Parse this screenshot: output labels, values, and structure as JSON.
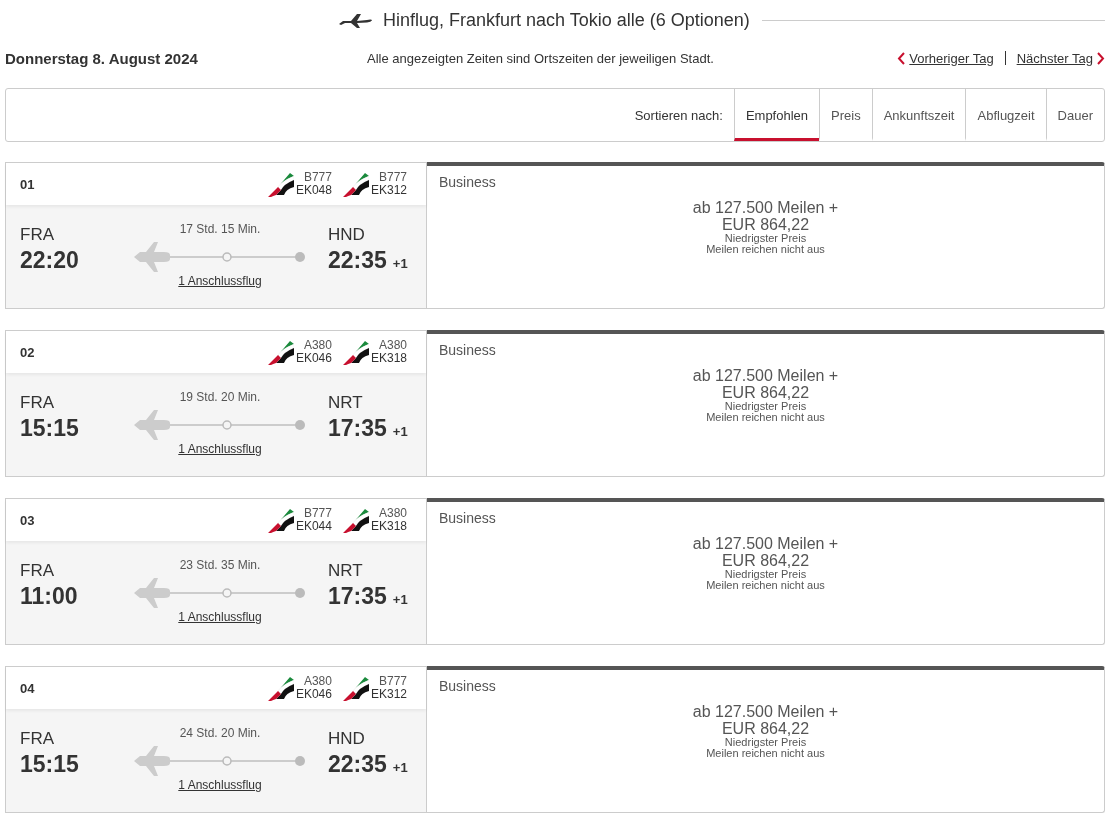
{
  "header": {
    "title": "Hinflug, Frankfurt nach Tokio alle (6 Optionen)"
  },
  "date": "Donnerstag 8. August 2024",
  "note": "Alle angezeigten Zeiten sind Ortszeiten der jeweiligen Stadt.",
  "nav": {
    "previous": "Vorheriger Tag",
    "next": "Nächster Tag"
  },
  "sort": {
    "label": "Sortieren nach:",
    "options": [
      {
        "label": "Empfohlen",
        "selected": true
      },
      {
        "label": "Preis",
        "selected": false
      },
      {
        "label": "Ankunftszeit",
        "selected": false
      },
      {
        "label": "Abflugzeit",
        "selected": false
      },
      {
        "label": "Dauer",
        "selected": false
      }
    ]
  },
  "flights": [
    {
      "number": "01",
      "legs": [
        {
          "aircraft": "B777",
          "flight": "EK048"
        },
        {
          "aircraft": "B777",
          "flight": "EK312"
        }
      ],
      "from": "FRA",
      "dep": "22:20",
      "duration": "17 Std. 15 Min.",
      "stops": "1 Anschlussflug",
      "to": "HND",
      "arr": "22:35",
      "day_offset": "+1",
      "fare": {
        "cabin": "Business",
        "miles": "ab 127.500 Meilen +",
        "price": "EUR 864,22",
        "tag": "Niedrigster Preis",
        "note": "Meilen reichen nicht aus"
      }
    },
    {
      "number": "02",
      "legs": [
        {
          "aircraft": "A380",
          "flight": "EK046"
        },
        {
          "aircraft": "A380",
          "flight": "EK318"
        }
      ],
      "from": "FRA",
      "dep": "15:15",
      "duration": "19 Std. 20 Min.",
      "stops": "1 Anschlussflug",
      "to": "NRT",
      "arr": "17:35",
      "day_offset": "+1",
      "fare": {
        "cabin": "Business",
        "miles": "ab 127.500 Meilen +",
        "price": "EUR 864,22",
        "tag": "Niedrigster Preis",
        "note": "Meilen reichen nicht aus"
      }
    },
    {
      "number": "03",
      "legs": [
        {
          "aircraft": "B777",
          "flight": "EK044"
        },
        {
          "aircraft": "A380",
          "flight": "EK318"
        }
      ],
      "from": "FRA",
      "dep": "11:00",
      "duration": "23 Std. 35 Min.",
      "stops": "1 Anschlussflug",
      "to": "NRT",
      "arr": "17:35",
      "day_offset": "+1",
      "fare": {
        "cabin": "Business",
        "miles": "ab 127.500 Meilen +",
        "price": "EUR 864,22",
        "tag": "Niedrigster Preis",
        "note": "Meilen reichen nicht aus"
      }
    },
    {
      "number": "04",
      "legs": [
        {
          "aircraft": "A380",
          "flight": "EK046"
        },
        {
          "aircraft": "B777",
          "flight": "EK312"
        }
      ],
      "from": "FRA",
      "dep": "15:15",
      "duration": "24 Std. 20 Min.",
      "stops": "1 Anschlussflug",
      "to": "HND",
      "arr": "22:35",
      "day_offset": "+1",
      "fare": {
        "cabin": "Business",
        "miles": "ab 127.500 Meilen +",
        "price": "EUR 864,22",
        "tag": "Niedrigster Preis",
        "note": "Meilen reichen nicht aus"
      }
    }
  ]
}
